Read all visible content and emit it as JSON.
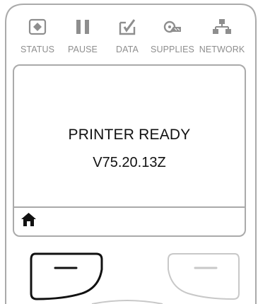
{
  "indicators": [
    {
      "label": "STATUS",
      "icon": "status-diamond-icon"
    },
    {
      "label": "PAUSE",
      "icon": "pause-icon"
    },
    {
      "label": "DATA",
      "icon": "data-icon"
    },
    {
      "label": "SUPPLIES",
      "icon": "supplies-icon"
    },
    {
      "label": "NETWORK",
      "icon": "network-icon"
    }
  ],
  "screen": {
    "status": "PRINTER READY",
    "version": "V75.20.13Z",
    "home_icon": "home-icon"
  },
  "softkeys": [
    {
      "icon": "dash-icon",
      "active": true
    },
    {
      "icon": "dash-icon",
      "active": false
    }
  ],
  "colors": {
    "outline": "#aaaaaa",
    "icon_gray": "#8e8e8e",
    "text": "#111111",
    "active_key": "#111111",
    "inactive_key": "#c8c8c8"
  }
}
